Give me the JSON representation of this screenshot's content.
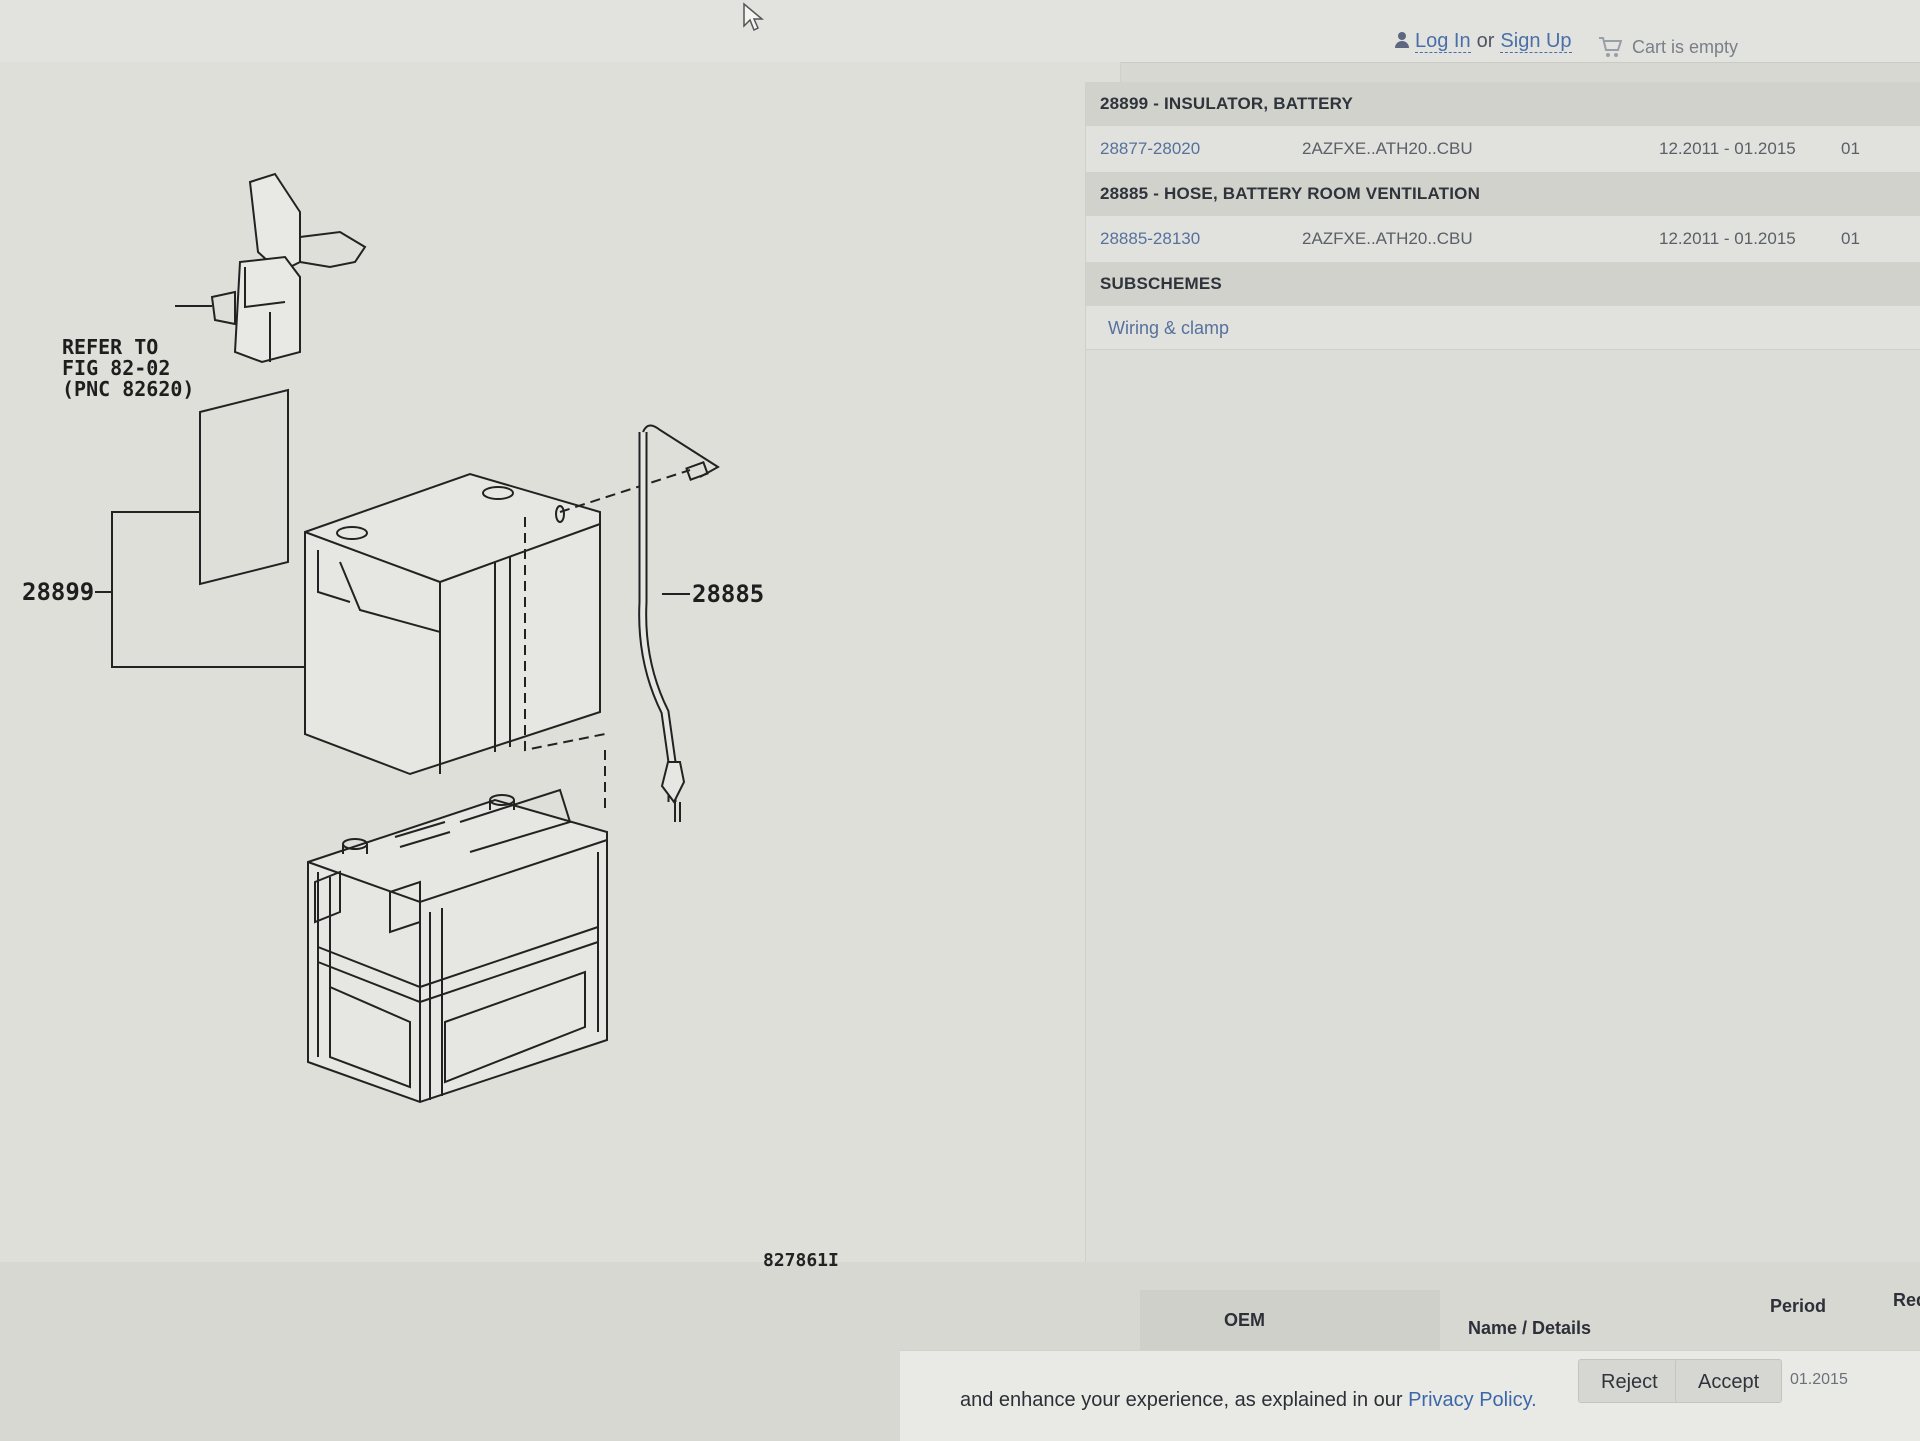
{
  "header": {
    "login_label": "Log In",
    "or_label": "or",
    "signup_label": "Sign Up",
    "cart_label": "Cart is empty"
  },
  "diagram": {
    "refer_line1": "REFER TO",
    "refer_line2": "FIG 82-02",
    "refer_line3": "(PNC 82620)",
    "callout_insulator": "28899",
    "callout_hose": "28885",
    "figure_id": "827861I"
  },
  "parts": {
    "sections": [
      {
        "header": "28899 - INSULATOR, BATTERY",
        "rows": [
          {
            "part_number": "28877-28020",
            "model": "2AZFXE..ATH20..CBU",
            "period": "12.2011 - 01.2015",
            "qty": "01"
          }
        ]
      },
      {
        "header": "28885 - HOSE, BATTERY ROOM VENTILATION",
        "rows": [
          {
            "part_number": "28885-28130",
            "model": "2AZFXE..ATH20..CBU",
            "period": "12.2011 - 01.2015",
            "qty": "01"
          }
        ]
      }
    ],
    "subschemes_header": "SUBSCHEMES",
    "subschemes": [
      "Wiring & clamp"
    ]
  },
  "table": {
    "col_oem": "OEM",
    "col_name": "Name / Details",
    "col_period": "Period",
    "col_req": "Req"
  },
  "cookie": {
    "text": "and enhance your experience, as explained in our",
    "link": "Privacy Policy.",
    "reject": "Reject",
    "accept": "Accept",
    "date_fragment": "01.2015"
  }
}
